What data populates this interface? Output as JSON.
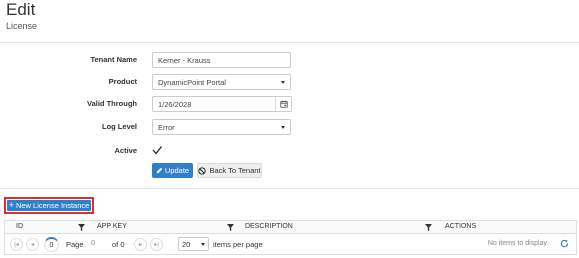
{
  "header": {
    "title": "Edit",
    "subtitle": "License"
  },
  "form": {
    "tenant_name": {
      "label": "Tenant Name",
      "value": "Kerner - Krauss"
    },
    "product": {
      "label": "Product",
      "value": "DynamicPoint Portal"
    },
    "valid_through": {
      "label": "Valid Through",
      "value": "1/26/2028"
    },
    "log_level": {
      "label": "Log Level",
      "value": "Error"
    },
    "active": {
      "label": "Active",
      "checked": true
    }
  },
  "actions": {
    "update_label": "Update",
    "back_label": "Back To Tenant"
  },
  "new_license_label": "New License Instance",
  "grid": {
    "columns": [
      "ID",
      "APP KEY",
      "DESCRIPTION",
      "ACTIONS"
    ],
    "pager": {
      "current_page": "0",
      "page_label": "Page",
      "page_input": "0",
      "of_label": "of 0",
      "page_size": "20",
      "items_per_page_label": "items per page",
      "no_items": "No items to display"
    }
  },
  "colors": {
    "primary": "#2f80c9",
    "highlight_border": "#d9302f"
  }
}
